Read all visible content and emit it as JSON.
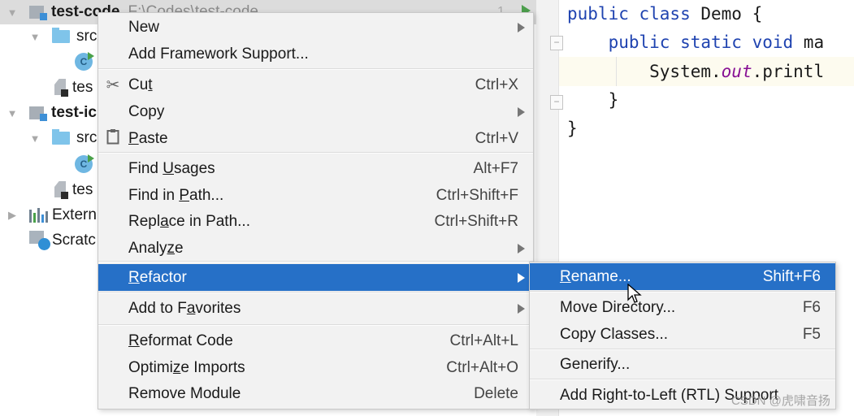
{
  "tree": {
    "rows": [
      {
        "id": "test-code",
        "label": "test-code",
        "hint": "F:\\Codes\\test-code",
        "icon": "module-icon",
        "expanded": true,
        "selected": true
      },
      {
        "id": "src-1",
        "label": "src",
        "icon": "folder-icon",
        "expanded": true
      },
      {
        "id": "class-1",
        "label": "C",
        "icon": "java-class-icon"
      },
      {
        "id": "iml-1",
        "label": "tes",
        "icon": "iml-file-icon"
      },
      {
        "id": "test-idea",
        "label": "test-ic",
        "icon": "module-icon",
        "expanded": true
      },
      {
        "id": "src-2",
        "label": "src",
        "icon": "folder-icon",
        "expanded": true
      },
      {
        "id": "class-2",
        "label": "C",
        "icon": "java-class-icon"
      },
      {
        "id": "iml-2",
        "label": "tes",
        "icon": "iml-file-icon"
      },
      {
        "id": "ext-libs",
        "label": "Extern",
        "icon": "libraries-icon",
        "expanded": false
      },
      {
        "id": "scratches",
        "label": "Scratc",
        "icon": "scratches-icon"
      }
    ]
  },
  "editor": {
    "line_number": "1",
    "lines": [
      {
        "parts": [
          {
            "t": "public class ",
            "c": "kw"
          },
          {
            "t": "Demo {",
            "c": ""
          }
        ]
      },
      {
        "parts": [
          {
            "t": "    public static void ",
            "c": "kw"
          },
          {
            "t": "ma",
            "c": ""
          }
        ]
      },
      {
        "parts": [
          {
            "t": "        System.",
            "c": ""
          },
          {
            "t": "out",
            "c": "it"
          },
          {
            "t": ".printl",
            "c": ""
          }
        ]
      },
      {
        "parts": [
          {
            "t": "    }",
            "c": ""
          }
        ]
      },
      {
        "parts": [
          {
            "t": "}",
            "c": ""
          }
        ]
      }
    ]
  },
  "context_menu": {
    "items": [
      {
        "label": "New",
        "submenu": true
      },
      {
        "label": "Add Framework Support..."
      },
      {
        "sep": true
      },
      {
        "label": "Cut",
        "mnemonic": "t",
        "shortcut": "Ctrl+X",
        "icon": "cut-icon"
      },
      {
        "label": "Copy",
        "submenu": true
      },
      {
        "label": "Paste",
        "mnemonic": "P",
        "shortcut": "Ctrl+V",
        "icon": "paste-icon"
      },
      {
        "sep": true
      },
      {
        "label": "Find Usages",
        "mnemonic": "U",
        "shortcut": "Alt+F7"
      },
      {
        "label": "Find in Path...",
        "mnemonic": "P",
        "shortcut": "Ctrl+Shift+F"
      },
      {
        "label": "Replace in Path...",
        "mnemonic": "a",
        "shortcut": "Ctrl+Shift+R"
      },
      {
        "label": "Analyze",
        "mnemonic": "z",
        "submenu": true
      },
      {
        "sep": true
      },
      {
        "label": "Refactor",
        "mnemonic": "R",
        "submenu": true,
        "active": true
      },
      {
        "sep": true
      },
      {
        "label": "Add to Favorites",
        "mnemonic": "a",
        "submenu": true
      },
      {
        "sep": true
      },
      {
        "label": "Reformat Code",
        "mnemonic": "R",
        "shortcut": "Ctrl+Alt+L"
      },
      {
        "label": "Optimize Imports",
        "mnemonic": "z",
        "shortcut": "Ctrl+Alt+O"
      },
      {
        "label": "Remove Module",
        "shortcut": "Delete"
      }
    ]
  },
  "refactor_submenu": {
    "items": [
      {
        "label": "Rename...",
        "mnemonic": "R",
        "shortcut": "Shift+F6",
        "active": true
      },
      {
        "sep": true
      },
      {
        "label": "Move Directory...",
        "shortcut": "F6"
      },
      {
        "label": "Copy Classes...",
        "shortcut": "F5"
      },
      {
        "sep": true
      },
      {
        "label": "Generify..."
      },
      {
        "sep": true
      },
      {
        "label": "Add Right-to-Left (RTL) Support"
      }
    ]
  },
  "watermark": "CSDN @虎啸音扬",
  "colors": {
    "accent": "#2670c7",
    "menu_bg": "#f2f2f2",
    "keyword": "#1f43b0",
    "static_field": "#871094"
  }
}
